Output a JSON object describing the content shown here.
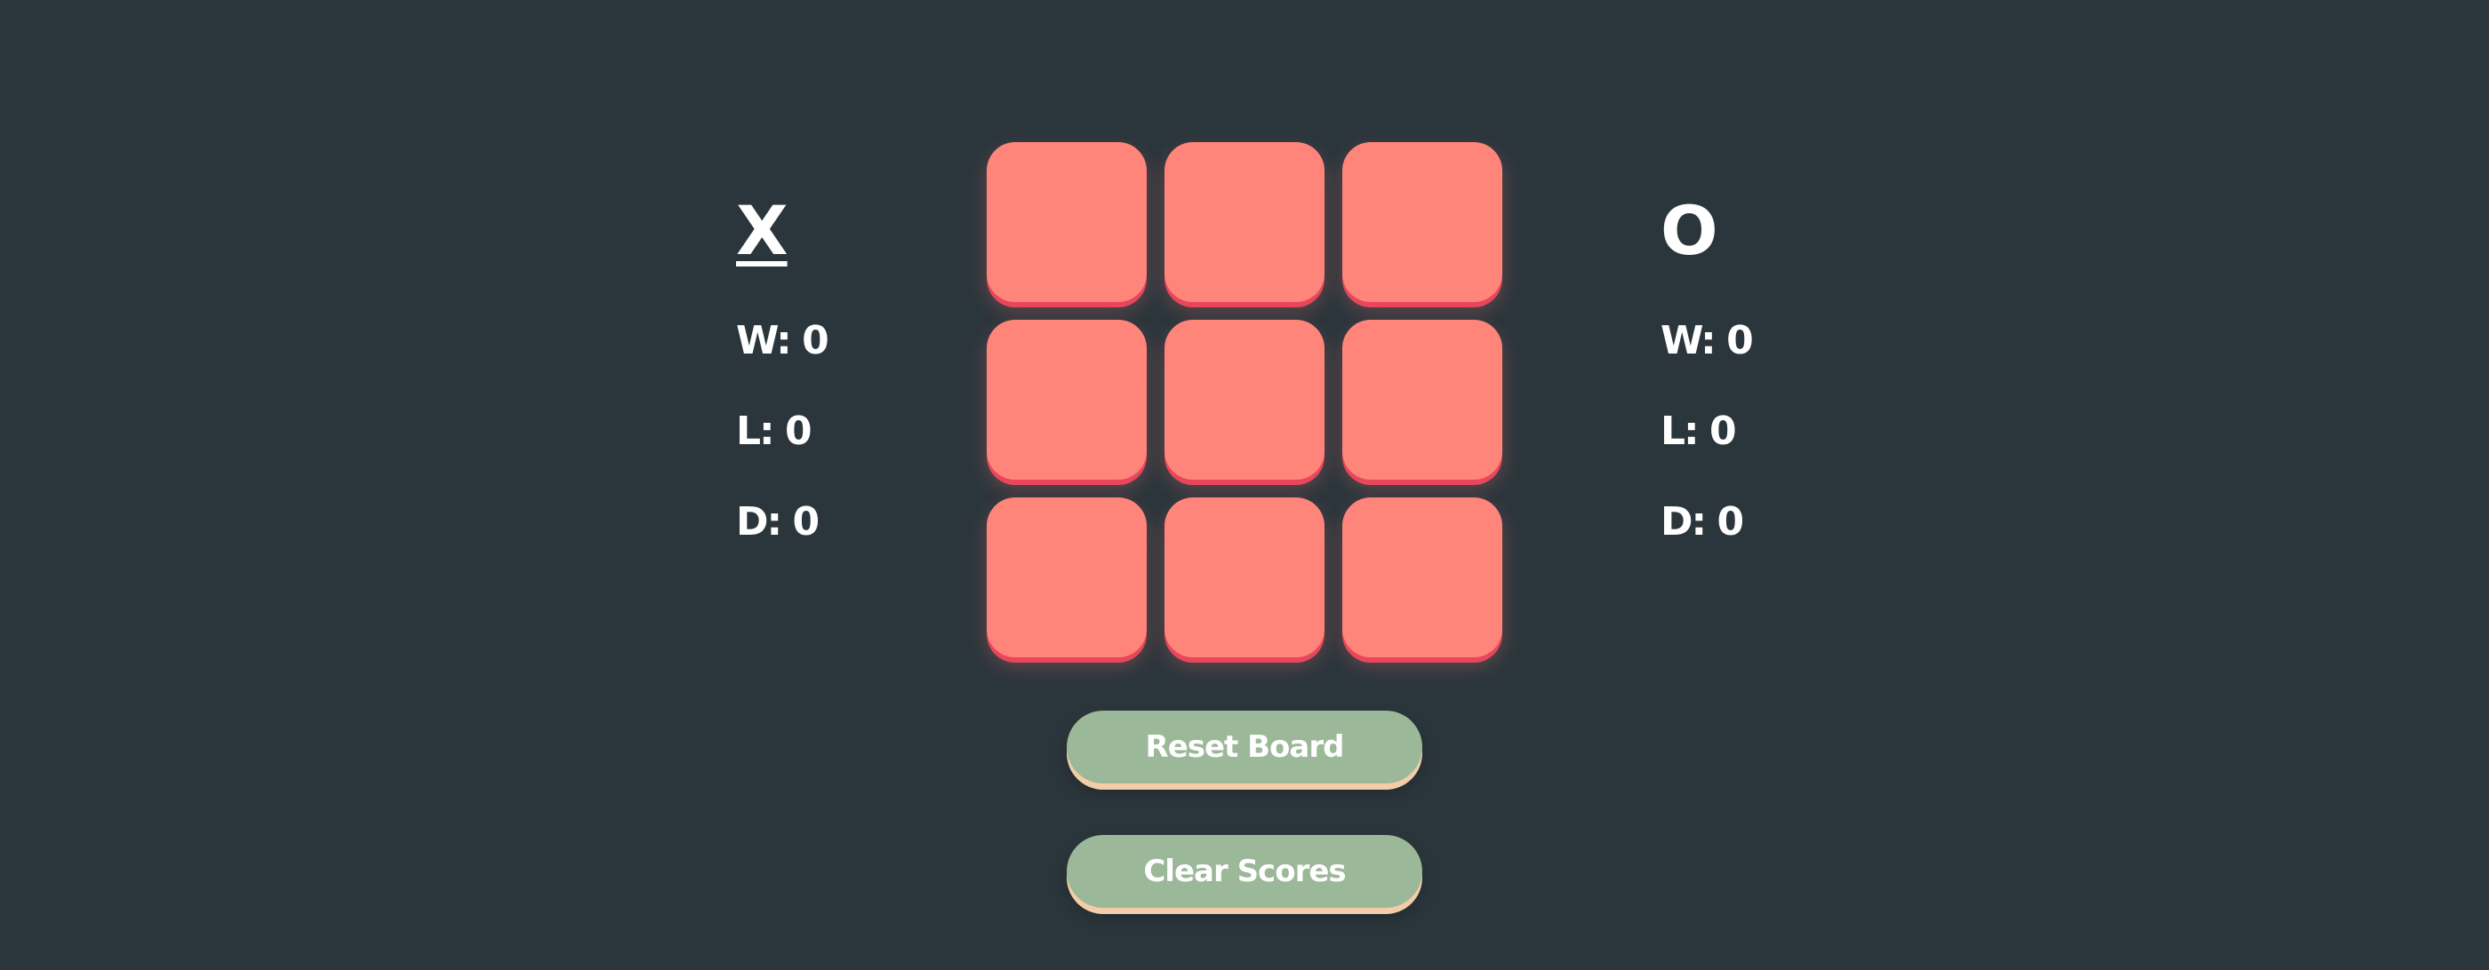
{
  "players": [
    {
      "name": "X",
      "active": true,
      "wins_label": "W: 0",
      "losses_label": "L: 0",
      "draws_label": "D: 0"
    },
    {
      "name": "O",
      "active": false,
      "wins_label": "W: 0",
      "losses_label": "L: 0",
      "draws_label": "D: 0"
    }
  ],
  "board": {
    "cells": [
      "",
      "",
      "",
      "",
      "",
      "",
      "",
      "",
      ""
    ]
  },
  "buttons": {
    "reset_label": "Reset Board",
    "clear_label": "Clear Scores"
  },
  "colors": {
    "background": "#2b363c",
    "cell": "#ff857b",
    "cell_shadow": "#e9465b",
    "button": "#9bb899",
    "button_shadow": "#f4cda8",
    "text": "#ffffff"
  }
}
